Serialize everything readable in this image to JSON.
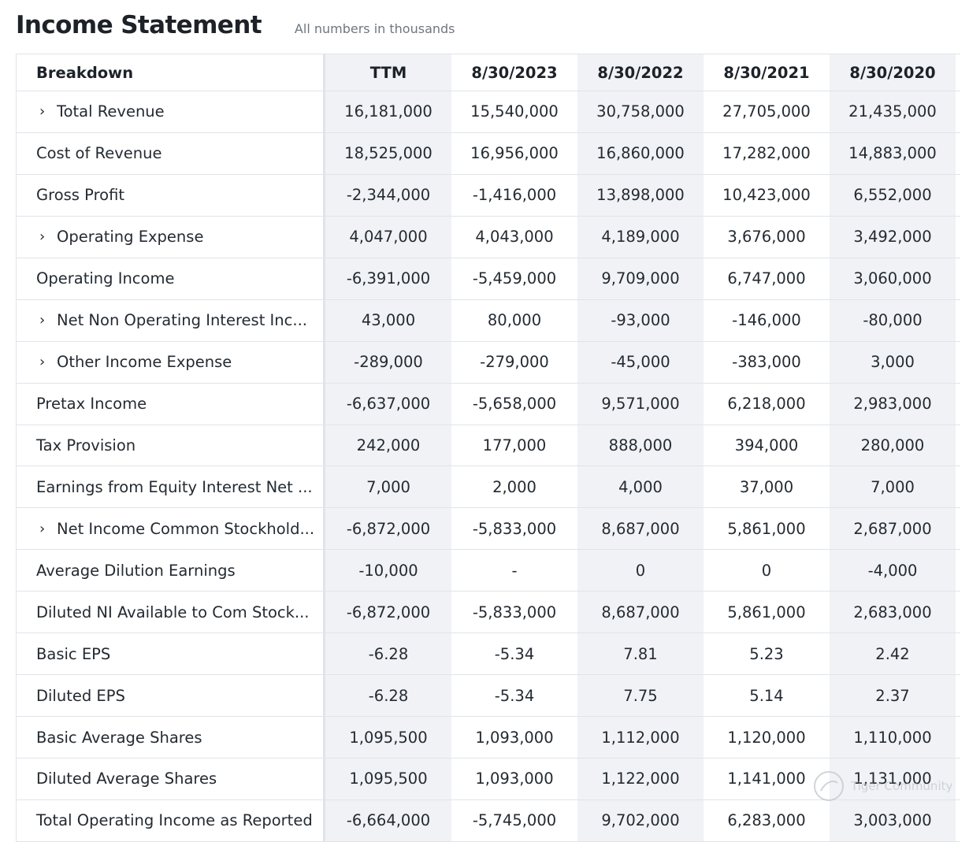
{
  "header": {
    "title": "Income Statement",
    "subtitle": "All numbers in thousands"
  },
  "table": {
    "columns": [
      "Breakdown",
      "TTM",
      "8/30/2023",
      "8/30/2022",
      "8/30/2021",
      "8/30/2020"
    ],
    "rows": [
      {
        "label": "Total Revenue",
        "expandable": true,
        "values": [
          "16,181,000",
          "15,540,000",
          "30,758,000",
          "27,705,000",
          "21,435,000"
        ]
      },
      {
        "label": "Cost of Revenue",
        "expandable": false,
        "values": [
          "18,525,000",
          "16,956,000",
          "16,860,000",
          "17,282,000",
          "14,883,000"
        ]
      },
      {
        "label": "Gross Profit",
        "expandable": false,
        "values": [
          "-2,344,000",
          "-1,416,000",
          "13,898,000",
          "10,423,000",
          "6,552,000"
        ]
      },
      {
        "label": "Operating Expense",
        "expandable": true,
        "values": [
          "4,047,000",
          "4,043,000",
          "4,189,000",
          "3,676,000",
          "3,492,000"
        ]
      },
      {
        "label": "Operating Income",
        "expandable": false,
        "values": [
          "-6,391,000",
          "-5,459,000",
          "9,709,000",
          "6,747,000",
          "3,060,000"
        ]
      },
      {
        "label": "Net Non Operating Interest Inc...",
        "expandable": true,
        "values": [
          "43,000",
          "80,000",
          "-93,000",
          "-146,000",
          "-80,000"
        ]
      },
      {
        "label": "Other Income Expense",
        "expandable": true,
        "values": [
          "-289,000",
          "-279,000",
          "-45,000",
          "-383,000",
          "3,000"
        ]
      },
      {
        "label": "Pretax Income",
        "expandable": false,
        "values": [
          "-6,637,000",
          "-5,658,000",
          "9,571,000",
          "6,218,000",
          "2,983,000"
        ]
      },
      {
        "label": "Tax Provision",
        "expandable": false,
        "values": [
          "242,000",
          "177,000",
          "888,000",
          "394,000",
          "280,000"
        ]
      },
      {
        "label": "Earnings from Equity Interest Net ...",
        "expandable": false,
        "values": [
          "7,000",
          "2,000",
          "4,000",
          "37,000",
          "7,000"
        ]
      },
      {
        "label": "Net Income Common Stockhold...",
        "expandable": true,
        "values": [
          "-6,872,000",
          "-5,833,000",
          "8,687,000",
          "5,861,000",
          "2,687,000"
        ]
      },
      {
        "label": "Average Dilution Earnings",
        "expandable": false,
        "values": [
          "-10,000",
          "-",
          "0",
          "0",
          "-4,000"
        ]
      },
      {
        "label": "Diluted NI Available to Com Stock...",
        "expandable": false,
        "values": [
          "-6,872,000",
          "-5,833,000",
          "8,687,000",
          "5,861,000",
          "2,683,000"
        ]
      },
      {
        "label": "Basic EPS",
        "expandable": false,
        "values": [
          "-6.28",
          "-5.34",
          "7.81",
          "5.23",
          "2.42"
        ]
      },
      {
        "label": "Diluted EPS",
        "expandable": false,
        "values": [
          "-6.28",
          "-5.34",
          "7.75",
          "5.14",
          "2.37"
        ]
      },
      {
        "label": "Basic Average Shares",
        "expandable": false,
        "values": [
          "1,095,500",
          "1,093,000",
          "1,112,000",
          "1,120,000",
          "1,110,000"
        ]
      },
      {
        "label": "Diluted Average Shares",
        "expandable": false,
        "values": [
          "1,095,500",
          "1,093,000",
          "1,122,000",
          "1,141,000",
          "1,131,000"
        ]
      },
      {
        "label": "Total Operating Income as Reported",
        "expandable": false,
        "values": [
          "-6,664,000",
          "-5,745,000",
          "9,702,000",
          "6,283,000",
          "3,003,000"
        ]
      }
    ]
  },
  "icons": {
    "expand": "chevron-right-icon"
  },
  "watermark": {
    "text": "Tiger Community"
  }
}
